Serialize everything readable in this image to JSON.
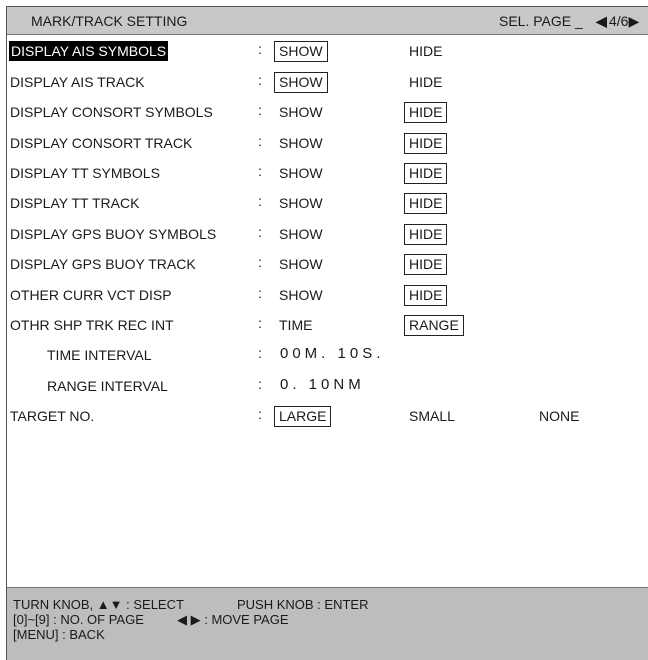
{
  "header": {
    "title": "MARK/TRACK SETTING",
    "sel_page": "SEL. PAGE _",
    "page_arrow": "◀",
    "page_number": "4/6▶"
  },
  "rows": [
    {
      "label": "DISPLAY AIS SYMBOLS",
      "options": [
        "SHOW",
        "HIDE"
      ],
      "selected": "SHOW"
    },
    {
      "label": "DISPLAY AIS TRACK",
      "options": [
        "SHOW",
        "HIDE"
      ],
      "selected": "SHOW"
    },
    {
      "label": "DISPLAY CONSORT SYMBOLS",
      "options": [
        "SHOW",
        "HIDE"
      ],
      "selected": "HIDE"
    },
    {
      "label": "DISPLAY CONSORT TRACK",
      "options": [
        "SHOW",
        "HIDE"
      ],
      "selected": "HIDE"
    },
    {
      "label": "DISPLAY TT SYMBOLS",
      "options": [
        "SHOW",
        "HIDE"
      ],
      "selected": "HIDE"
    },
    {
      "label": "DISPLAY TT TRACK",
      "options": [
        "SHOW",
        "HIDE"
      ],
      "selected": "HIDE"
    },
    {
      "label": "DISPLAY GPS BUOY SYMBOLS",
      "options": [
        "SHOW",
        "HIDE"
      ],
      "selected": "HIDE"
    },
    {
      "label": "DISPLAY GPS BUOY TRACK",
      "options": [
        "SHOW",
        "HIDE"
      ],
      "selected": "HIDE"
    },
    {
      "label": "OTHER CURR VCT DISP",
      "options": [
        "SHOW",
        "HIDE"
      ],
      "selected": "HIDE"
    },
    {
      "label": "OTHR SHP TRK REC INT",
      "options": [
        "TIME",
        "RANGE"
      ],
      "selected": "RANGE"
    },
    {
      "label": "TIME INTERVAL",
      "value": "00M. 10S."
    },
    {
      "label": "RANGE INTERVAL",
      "value": "0. 10NM"
    },
    {
      "label": "TARGET NO.",
      "options": [
        "LARGE",
        "SMALL",
        "NONE"
      ],
      "selected": "LARGE"
    }
  ],
  "colon": ":",
  "footer": {
    "line1_a": "TURN KNOB, ▲▼ : SELECT",
    "line1_b": "PUSH KNOB : ENTER",
    "line2_a": "[0]~[9] : NO. OF PAGE",
    "line2_b": "◀ ▶ : MOVE PAGE",
    "line3": "[MENU] : BACK"
  },
  "colors": {
    "header_bg": "#c8c8c8",
    "footer_bg": "#bdbdbd",
    "selected_label_bg": "#000000"
  }
}
